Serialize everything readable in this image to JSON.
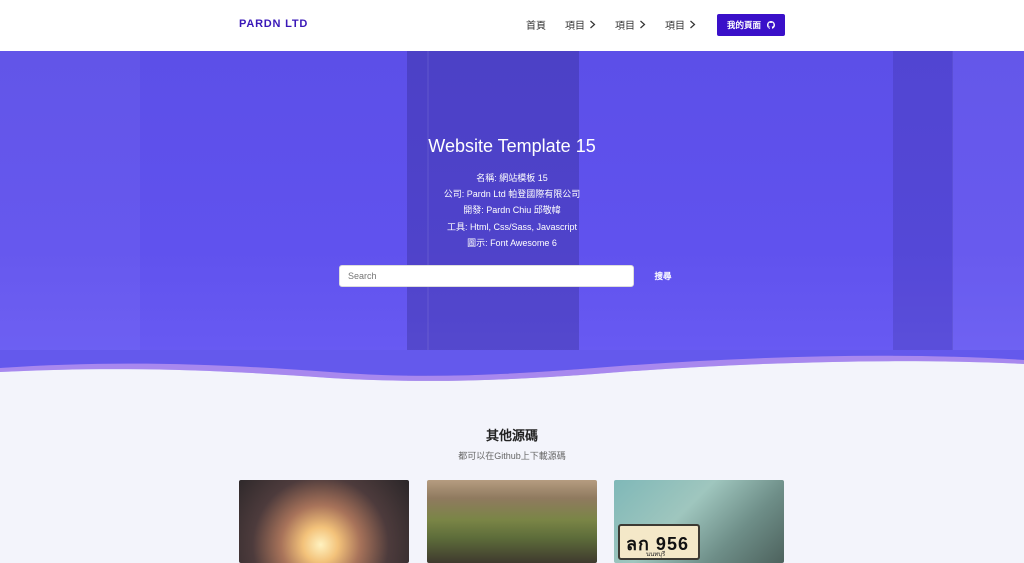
{
  "brand": {
    "logo": "PARDN LTD",
    "accent": "#3a10c9"
  },
  "nav": {
    "items": [
      {
        "label": "首頁",
        "has_chevron": false
      },
      {
        "label": "項目",
        "has_chevron": true
      },
      {
        "label": "項目",
        "has_chevron": true
      },
      {
        "label": "項目",
        "has_chevron": true
      }
    ],
    "cta_label": "我的頁面",
    "cta_icon": "github-icon"
  },
  "hero": {
    "title": "Website Template 15",
    "lines": [
      "名稱: 網站模板 15",
      "公司: Pardn Ltd 帕登國際有限公司",
      "開發: Pardn Chiu 邱敬幃",
      "工具: Html, Css/Sass, Javascript",
      "圖示: Font Awesome 6"
    ],
    "search_placeholder": "Search",
    "search_button": "搜尋",
    "bg_color": "#5c4fe8"
  },
  "section": {
    "title": "其他源碼",
    "subtitle": "都可以在Github上下載源碼",
    "cards": [
      {
        "image": "sunset-forest-photo"
      },
      {
        "image": "mossy-log-photo"
      },
      {
        "image": "license-plate-photo",
        "plate_text": "ลก 956",
        "plate_sub": "นนทบุรี"
      }
    ]
  }
}
